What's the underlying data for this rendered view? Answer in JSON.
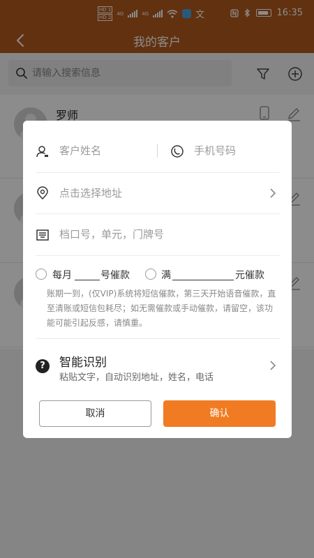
{
  "status_bar": {
    "time": "16:35",
    "network_badge_1": "HD 1",
    "network_badge_2": "HD 2",
    "net_type_1": "4G",
    "net_type_2": "4G",
    "ime_glyph": "文"
  },
  "header": {
    "title": "我的客户"
  },
  "search": {
    "placeholder": "请输入搜索信息",
    "value": ""
  },
  "customers": [
    {
      "name": "罗师"
    }
  ],
  "dialog": {
    "name_placeholder": "客户姓名",
    "phone_placeholder": "手机号码",
    "address_placeholder": "点击选择地址",
    "unit_placeholder": "档口号，单元，门牌号",
    "dunning": {
      "opt1_prefix": "每月",
      "opt1_suffix": "号催款",
      "opt2_prefix": "满",
      "opt2_suffix": "元催款"
    },
    "notice": "账期一到，(仅VIP)系统将短信催款，第三天开始语音催款，直至清账或短信包耗尽；如无需催款或手动催款，请留空，该功能可能引起反感，请慎重。",
    "smart": {
      "title": "智能识别",
      "subtitle": "粘贴文字，自动识别地址，姓名，电话"
    },
    "cancel_label": "取消",
    "confirm_label": "确认"
  },
  "colors": {
    "header_bg": "#b2591c",
    "confirm_bg": "#f07b22"
  }
}
